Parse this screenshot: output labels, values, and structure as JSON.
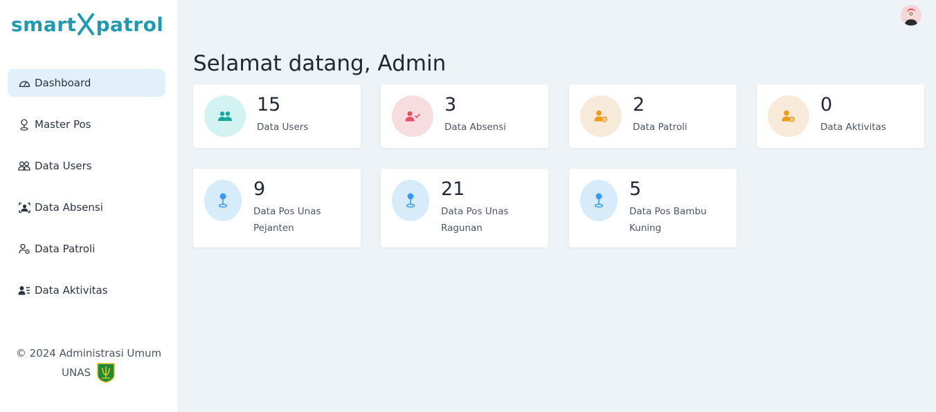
{
  "brand": {
    "part1": "smart",
    "part2": "patrol",
    "color": "#1e9bb0"
  },
  "sidebar": {
    "items": [
      {
        "label": "Dashboard",
        "icon": "dashboard-gauge-icon",
        "active": true
      },
      {
        "label": "Master Pos",
        "icon": "person-pin-icon"
      },
      {
        "label": "Data Users",
        "icon": "users-icon"
      },
      {
        "label": "Data Absensi",
        "icon": "user-id-frame-icon"
      },
      {
        "label": "Data Patroli",
        "icon": "user-gear-icon"
      },
      {
        "label": "Data Aktivitas",
        "icon": "user-list-icon"
      }
    ],
    "footer_line1": "© 2024 Administrasi Umum",
    "footer_line2": "UNAS"
  },
  "header": {
    "avatar_icon": "user-avatar-icon"
  },
  "main": {
    "title": "Selamat datang, Admin",
    "cards_row1": [
      {
        "value": "15",
        "label": "Data Users",
        "icon": "users-icon",
        "bg": "#d3f2f2",
        "fg": "#17a9a0"
      },
      {
        "value": "3",
        "label": "Data Absensi",
        "icon": "user-check-icon",
        "bg": "#f8dde0",
        "fg": "#ee4d68"
      },
      {
        "value": "2",
        "label": "Data Patroli",
        "icon": "user-gear-icon",
        "bg": "#f8ead9",
        "fg": "#ee9a12"
      },
      {
        "value": "0",
        "label": "Data Aktivitas",
        "icon": "user-gear-icon",
        "bg": "#f8ead9",
        "fg": "#ee9a12"
      }
    ],
    "cards_row2": [
      {
        "value": "9",
        "label_line1": "Data Pos Unas",
        "label_line2": "Pejanten",
        "icon": "map-pin-icon",
        "bg": "#d6ecfb",
        "fg": "#3b9af0"
      },
      {
        "value": "21",
        "label_line1": "Data Pos Unas",
        "label_line2": "Ragunan",
        "icon": "map-pin-icon",
        "bg": "#d6ecfb",
        "fg": "#3b9af0"
      },
      {
        "value": "5",
        "label_line1": "Data Pos Bambu",
        "label_line2": "Kuning",
        "icon": "map-pin-icon",
        "bg": "#d6ecfb",
        "fg": "#3b9af0"
      }
    ]
  }
}
